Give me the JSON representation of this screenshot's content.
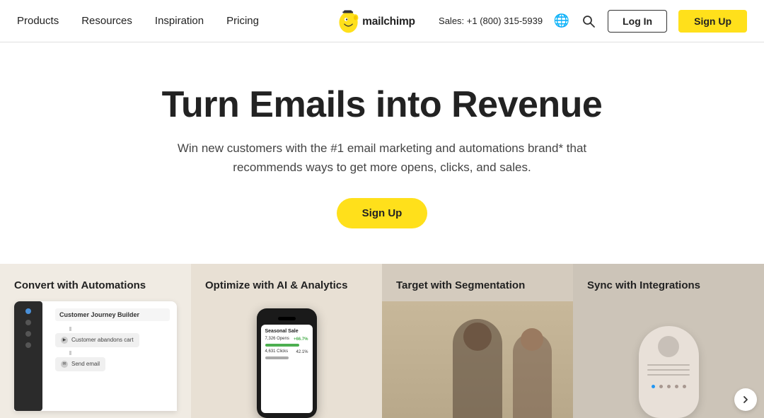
{
  "nav": {
    "products_label": "Products",
    "resources_label": "Resources",
    "inspiration_label": "Inspiration",
    "pricing_label": "Pricing",
    "sales_text": "Sales: +1 (800) 315-5939",
    "login_label": "Log In",
    "signup_label": "Sign Up"
  },
  "hero": {
    "headline": "Turn Emails into Revenue",
    "subheadline": "Win new customers with the #1 email marketing and automations brand* that recommends ways to get more opens, clicks, and sales.",
    "cta_label": "Sign Up"
  },
  "features": [
    {
      "title": "Convert with Automations",
      "mockup_header": "Customer Journey Builder",
      "mockup_node": "Customer abandons cart"
    },
    {
      "title": "Optimize with AI & Analytics",
      "phone_title": "Seasonal Sale",
      "stat1": "7,326 Opens",
      "stat1_pct": "+66.7%",
      "stat2": "4,631 Clicks",
      "stat2_pct": "42.1%"
    },
    {
      "title": "Target with Segmentation"
    },
    {
      "title": "Sync with Integrations",
      "dots": [
        "●",
        "○",
        "○",
        "○",
        "○"
      ]
    }
  ]
}
